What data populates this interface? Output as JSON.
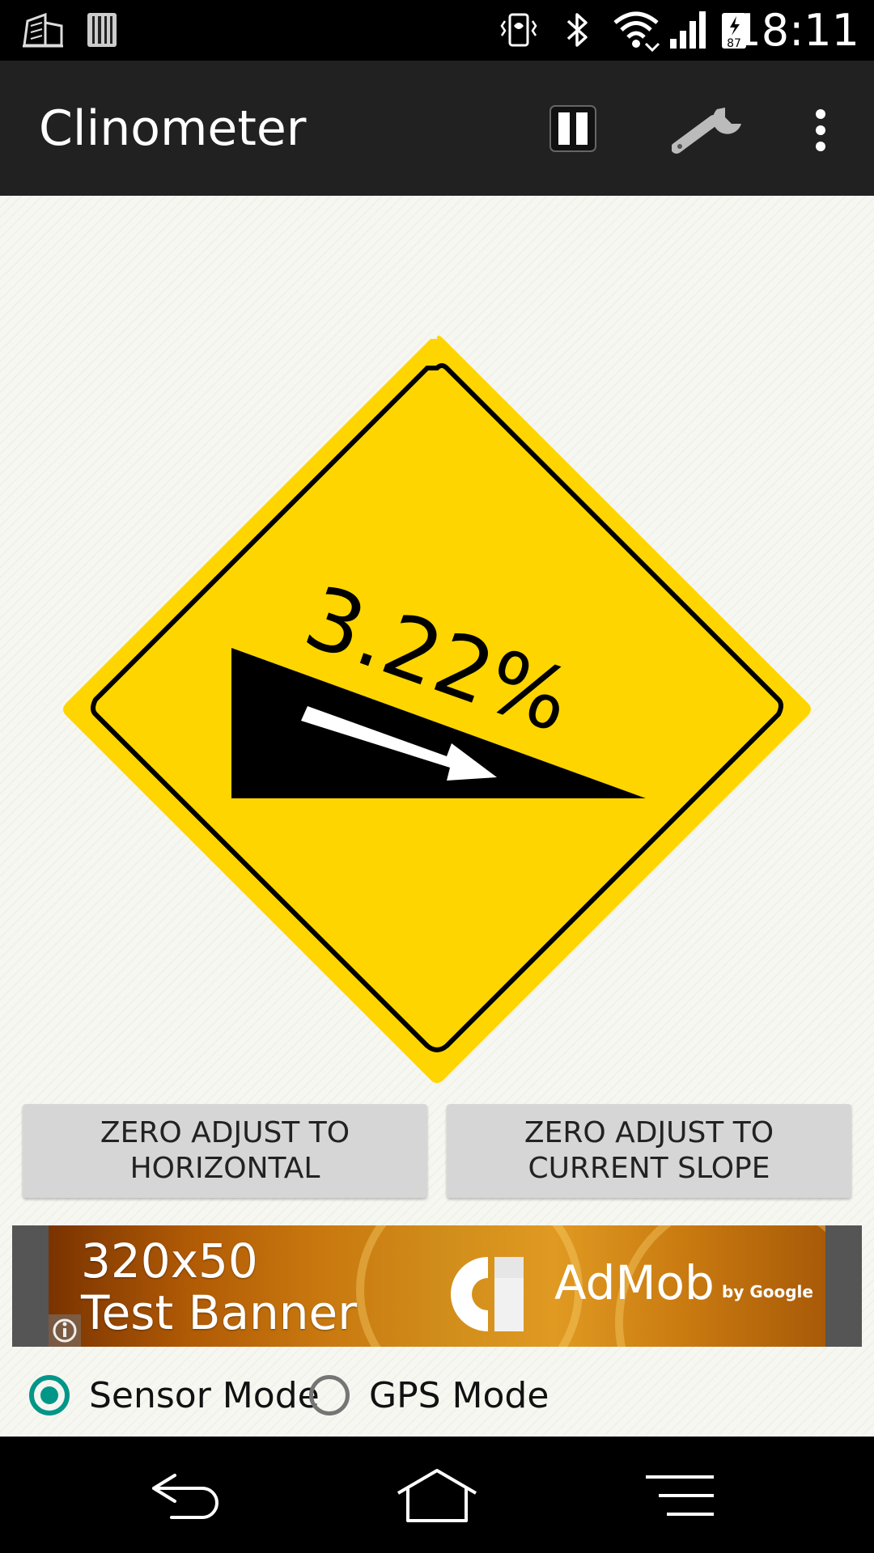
{
  "status_bar": {
    "time": "18:11",
    "battery_level": "87",
    "icons": [
      "building-notification-icon",
      "barcode-notification-icon",
      "vibrate-icon",
      "bluetooth-icon",
      "wifi-icon",
      "signal-icon",
      "battery-icon"
    ]
  },
  "app_bar": {
    "title": "Clinometer",
    "actions": [
      "pause-icon",
      "wrench-icon",
      "overflow-menu-icon"
    ]
  },
  "gauge": {
    "slope_text": "3.22%",
    "slope_percent": 3.22,
    "direction": "downhill",
    "colors": {
      "sign": "#FFD500",
      "border": "#000000",
      "ramp": "#000000",
      "arrow": "#FFFFFF"
    }
  },
  "buttons": {
    "zero_horizontal": {
      "line1": "ZERO ADJUST TO",
      "line2": "HORIZONTAL"
    },
    "zero_current": {
      "line1": "ZERO ADJUST TO",
      "line2": "CURRENT SLOPE"
    }
  },
  "ad": {
    "size_text": "320x50",
    "banner_text": "Test Banner",
    "brand": "AdMob",
    "byline": "by Google"
  },
  "modes": {
    "sensor": {
      "label": "Sensor Mode",
      "selected": true
    },
    "gps": {
      "label": "GPS Mode",
      "selected": false
    },
    "accent_color": "#009688"
  },
  "nav_bar": {
    "buttons": [
      "back-icon",
      "home-icon",
      "menu-icon"
    ]
  }
}
